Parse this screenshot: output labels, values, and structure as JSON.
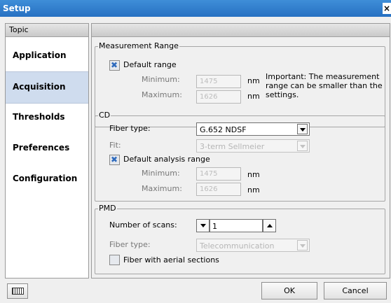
{
  "window": {
    "title": "Setup",
    "close_glyph": "×"
  },
  "topic": {
    "header": "Topic",
    "items": [
      {
        "label": "Application"
      },
      {
        "label": "Acquisition"
      },
      {
        "label": "Thresholds"
      },
      {
        "label": "Preferences"
      },
      {
        "label": "Configuration"
      }
    ],
    "active_index": 1
  },
  "measurement_range": {
    "title": "Measurement Range",
    "default_range_label": "Default range",
    "default_range_checked": true,
    "min_label": "Minimum:",
    "min_value": "1475",
    "max_label": "Maximum:",
    "max_value": "1626",
    "unit": "nm",
    "note": "Important: The measurement range can be smaller than the settings."
  },
  "cd": {
    "title": "CD",
    "fiber_type_label": "Fiber type:",
    "fiber_type_value": "G.652 NDSF",
    "fit_label": "Fit:",
    "fit_value": "3-term Sellmeier",
    "default_analysis_label": "Default analysis range",
    "default_analysis_checked": true,
    "min_label": "Minimum:",
    "min_value": "1475",
    "max_label": "Maximum:",
    "max_value": "1626",
    "unit": "nm"
  },
  "pmd": {
    "title": "PMD",
    "scans_label": "Number of scans:",
    "scans_value": "1",
    "fiber_type_label": "Fiber type:",
    "fiber_type_value": "Telecommunication",
    "aerial_label": "Fiber with aerial sections",
    "aerial_checked": false
  },
  "buttons": {
    "ok": "OK",
    "cancel": "Cancel"
  },
  "icons": {
    "keyboard": "keyboard-icon",
    "close": "close-icon"
  },
  "colors": {
    "titlebar": "#2f7ccc",
    "active_topic": "#cfdcee",
    "check_mark": "#2f6bbd"
  }
}
